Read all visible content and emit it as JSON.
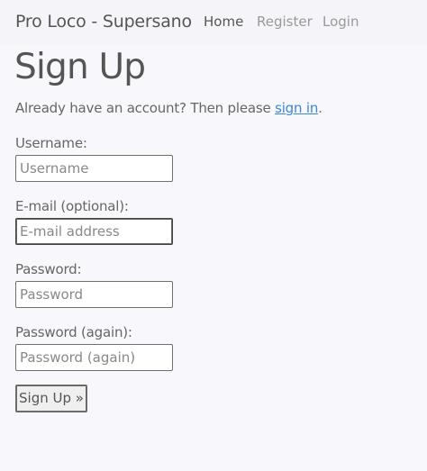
{
  "navbar": {
    "brand": "Pro Loco - Supersano",
    "links": [
      {
        "label": "Home"
      },
      {
        "label": "Register"
      },
      {
        "label": "Login"
      }
    ]
  },
  "page": {
    "title": "Sign Up",
    "intro_before": "Already have an account? Then please ",
    "intro_link": "sign in",
    "intro_after": "."
  },
  "form": {
    "username": {
      "label": "Username:",
      "placeholder": "Username",
      "value": ""
    },
    "email": {
      "label": "E-mail (optional):",
      "placeholder": "E-mail address",
      "value": ""
    },
    "password": {
      "label": "Password:",
      "placeholder": "Password",
      "value": ""
    },
    "password_again": {
      "label": "Password (again):",
      "placeholder": "Password (again)",
      "value": ""
    },
    "submit_label": "Sign Up »"
  },
  "colors": {
    "background": "#f8f7fb",
    "navbar": "#f5f4f8",
    "text": "#555555",
    "muted_link": "#999999",
    "link": "#3b86d8"
  }
}
